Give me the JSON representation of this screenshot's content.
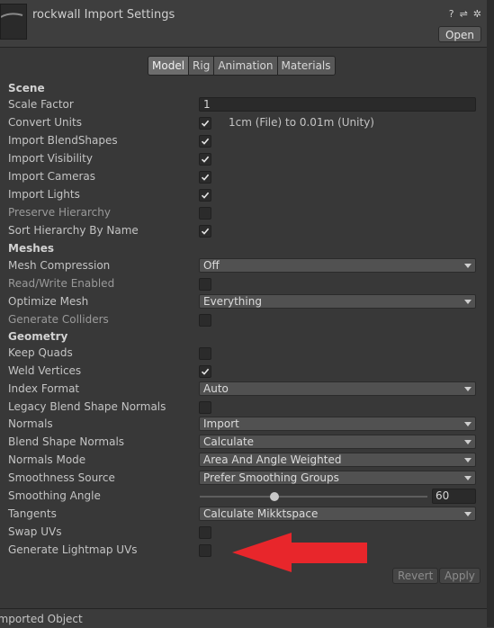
{
  "header": {
    "title": "rockwall Import Settings",
    "open_label": "Open",
    "icons": [
      "help-icon",
      "preset-icon",
      "settings-icon"
    ],
    "help_glyph": "?",
    "preset_glyph": "⇌",
    "settings_glyph": "✲"
  },
  "tabs": [
    {
      "label": "Model",
      "active": true
    },
    {
      "label": "Rig"
    },
    {
      "label": "Animation"
    },
    {
      "label": "Materials"
    }
  ],
  "scene": {
    "heading": "Scene",
    "scale_factor_label": "Scale Factor",
    "scale_factor_value": "1",
    "convert_units_label": "Convert Units",
    "convert_units_note": "1cm (File) to 0.01m (Unity)",
    "import_blendshapes_label": "Import BlendShapes",
    "import_visibility_label": "Import Visibility",
    "import_cameras_label": "Import Cameras",
    "import_lights_label": "Import Lights",
    "preserve_hierarchy_label": "Preserve Hierarchy",
    "sort_hierarchy_label": "Sort Hierarchy By Name"
  },
  "meshes": {
    "heading": "Meshes",
    "mesh_compression_label": "Mesh Compression",
    "mesh_compression_value": "Off",
    "read_write_label": "Read/Write Enabled",
    "optimize_mesh_label": "Optimize Mesh",
    "optimize_mesh_value": "Everything",
    "generate_colliders_label": "Generate Colliders"
  },
  "geometry": {
    "heading": "Geometry",
    "keep_quads_label": "Keep Quads",
    "weld_vertices_label": "Weld Vertices",
    "index_format_label": "Index Format",
    "index_format_value": "Auto",
    "legacy_blend_label": "Legacy Blend Shape Normals",
    "normals_label": "Normals",
    "normals_value": "Import",
    "blend_shape_normals_label": "Blend Shape Normals",
    "blend_shape_normals_value": "Calculate",
    "normals_mode_label": "Normals Mode",
    "normals_mode_value": "Area And Angle Weighted",
    "smoothness_source_label": "Smoothness Source",
    "smoothness_source_value": "Prefer Smoothing Groups",
    "smoothing_angle_label": "Smoothing Angle",
    "smoothing_angle_value": "60",
    "smoothing_angle_fraction": 0.33,
    "tangents_label": "Tangents",
    "tangents_value": "Calculate Mikktspace",
    "swap_uvs_label": "Swap UVs",
    "lightmap_uvs_label": "Generate Lightmap UVs"
  },
  "checkbox_states": {
    "convert_units": true,
    "import_blendshapes": true,
    "import_visibility": true,
    "import_cameras": true,
    "import_lights": true,
    "preserve_hierarchy": false,
    "sort_hierarchy": true,
    "read_write": false,
    "generate_colliders": false,
    "keep_quads": false,
    "weld_vertices": true,
    "legacy_blend": false,
    "swap_uvs": false,
    "lightmap_uvs": false
  },
  "buttons": {
    "revert_label": "Revert",
    "apply_label": "Apply"
  },
  "footer": {
    "label": "Imported Object"
  },
  "colors": {
    "background": "#383838",
    "arrow_annotation": "#e8262b"
  }
}
